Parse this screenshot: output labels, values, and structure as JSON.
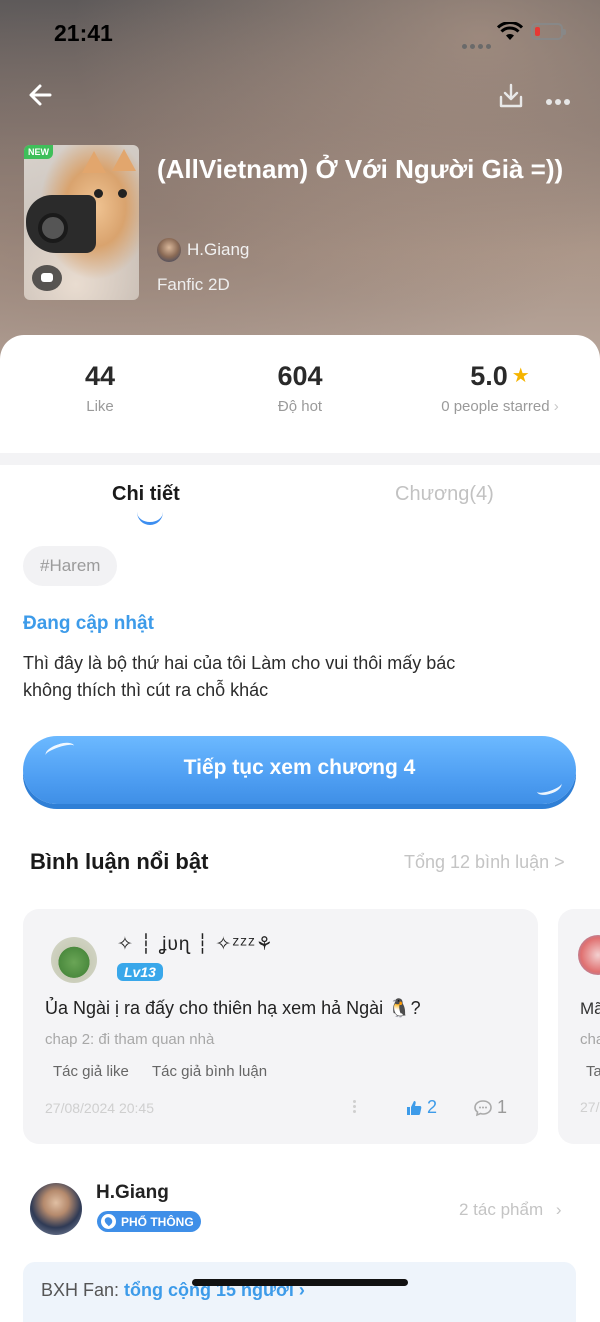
{
  "status_bar": {
    "time": "21:41"
  },
  "story": {
    "badge": "NEW",
    "title": "(AllVietnam) Ở Với Người Già =))",
    "author": "H.Giang",
    "genre": "Fanfic 2D"
  },
  "stats": {
    "likes": {
      "value": "44",
      "label": "Like"
    },
    "hot": {
      "value": "604",
      "label": "Độ hot"
    },
    "rating": {
      "value": "5.0",
      "label": "0 people starred"
    }
  },
  "tabs": [
    {
      "label": "Chi tiết",
      "active": true
    },
    {
      "label": "Chương(4)",
      "active": false
    }
  ],
  "detail": {
    "hashtag": "#Harem",
    "status": "Đang cập nhật",
    "description": "Thì đây là bộ thứ hai của tôi  Làm cho vui thôi mấy bác\nkhông thích thì cút ra chỗ khác",
    "continue_button": "Tiếp tục xem chương 4"
  },
  "comments_section": {
    "title": "Bình luận nổi bật",
    "total": "Tổng 12 bình luận >",
    "items": [
      {
        "user": "✧ ┆ ʝυɳ ┆ ✧ᶻᶻᶻ⚘",
        "level": "Lv13",
        "text": "Ủa Ngài ị ra đấy cho thiên hạ xem hả Ngài 🐧?",
        "chapter": "chap 2: đi tham quan nhà",
        "tags": [
          "Tác giả like",
          "Tác giả bình luận"
        ],
        "date": "27/08/2024 20:45",
        "likes": "2",
        "replies": "1"
      }
    ],
    "peek": {
      "text": "Mã",
      "sub": "cha",
      "tag": "Ta",
      "date": "27/"
    }
  },
  "author_section": {
    "name": "H.Giang",
    "badge": "PHỔ THÔNG",
    "works": "2 tác phẩm"
  },
  "fan_rank": {
    "label": "BXH Fan: ",
    "link": "tổng cộng 15 người"
  },
  "colors": {
    "accent": "#3d9be9",
    "button": "#4f9ff3",
    "star": "#f5b400",
    "new_badge": "#3fbf5a"
  }
}
